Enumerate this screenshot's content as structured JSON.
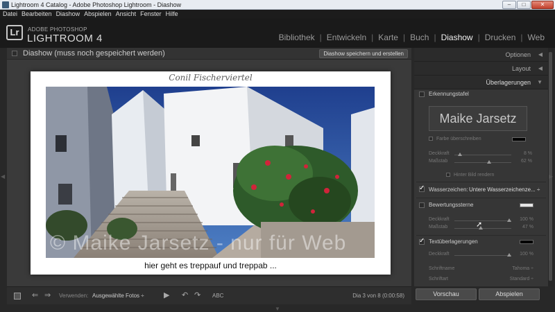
{
  "window": {
    "title": "Lightroom 4 Catalog - Adobe Photoshop Lightroom - Diashow",
    "min_label": "‒",
    "max_label": "□",
    "close_label": "✕"
  },
  "menu": [
    "Datei",
    "Bearbeiten",
    "Diashow",
    "Abspielen",
    "Ansicht",
    "Fenster",
    "Hilfe"
  ],
  "identity": {
    "badge": "Lr",
    "sub": "ADOBE PHOTOSHOP",
    "main": "LIGHTROOM 4"
  },
  "modules": [
    "Bibliothek",
    "Entwickeln",
    "Karte",
    "Buch",
    "Diashow",
    "Drucken",
    "Web"
  ],
  "active_module": "Diashow",
  "slideshow": {
    "title": "Diashow (muss noch gespeichert werden)",
    "save_button": "Diashow speichern und erstellen",
    "caption_top": "Conil Fischerviertel",
    "watermark": "© Maike Jarsetz - nur für Web",
    "caption_bottom": "hier geht es treppauf und treppab ..."
  },
  "toolbar": {
    "use_label": "Verwenden:",
    "use_value": "Ausgewählte Fotos ÷",
    "abc": "ABC",
    "count": "Dia 3 von 8 (0:00:58)"
  },
  "panel": {
    "sections": {
      "optionen": "Optionen",
      "layout": "Layout",
      "ueberlagerungen": "Überlagerungen"
    },
    "erkennungstafel": {
      "title": "Erkennungstafel",
      "plate_text": "Maike Jarsetz",
      "override_color": "Farbe überschreiben",
      "opacity_label": "Deckkraft",
      "opacity_value": "8 %",
      "scale_label": "Maßstab",
      "scale_value": "62 %",
      "behind": "Hinter Bild rendern"
    },
    "wasserzeichen": {
      "title": "Wasserzeichen:",
      "value": "Untere Wasserzeichenze... ÷"
    },
    "bewertungssterne": {
      "title": "Bewertungssterne",
      "opacity_label": "Deckkraft",
      "opacity_value": "100 %",
      "scale_label": "Maßstab",
      "scale_value": "47 %"
    },
    "textueberlagerungen": {
      "title": "Textüberlagerungen",
      "opacity_label": "Deckkraft",
      "opacity_value": "100 %",
      "font_label": "Schriftname",
      "font_value": "Tahoma ÷",
      "style_label": "Schriftart",
      "style_value": "Standard ÷"
    },
    "preview_button": "Vorschau",
    "play_button": "Abspielen"
  },
  "colors": {
    "identity_background": "#1a1a1a",
    "panel_background": "#363636",
    "main_background": "#3a3a3a"
  }
}
